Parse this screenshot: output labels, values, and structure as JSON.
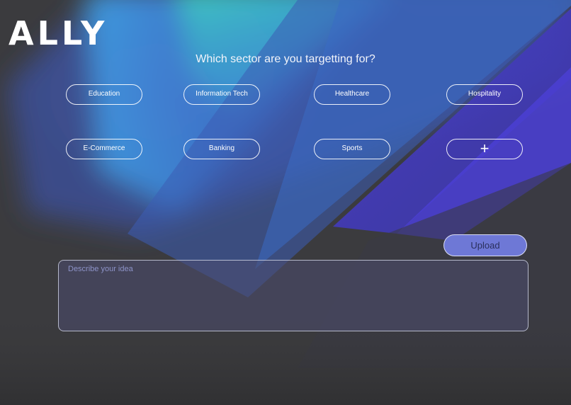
{
  "brand": {
    "logo_text": "ALLY"
  },
  "page": {
    "question": "Which sector are you targetting for?"
  },
  "sectors": [
    {
      "label": "Education"
    },
    {
      "label": "Information Tech"
    },
    {
      "label": "Healthcare"
    },
    {
      "label": "Hospitality"
    },
    {
      "label": "E-Commerce"
    },
    {
      "label": "Banking"
    },
    {
      "label": "Sports"
    },
    {
      "label": "+",
      "icon": "plus-icon"
    }
  ],
  "actions": {
    "upload_label": "Upload"
  },
  "idea_input": {
    "placeholder": "Describe your idea",
    "value": ""
  },
  "colors": {
    "background": "#3a3a3c",
    "accent_teal": "#37c6c0",
    "accent_blue": "#3f9be0",
    "accent_indigo": "#4b44c8",
    "upload_button": "#6e78d6"
  }
}
